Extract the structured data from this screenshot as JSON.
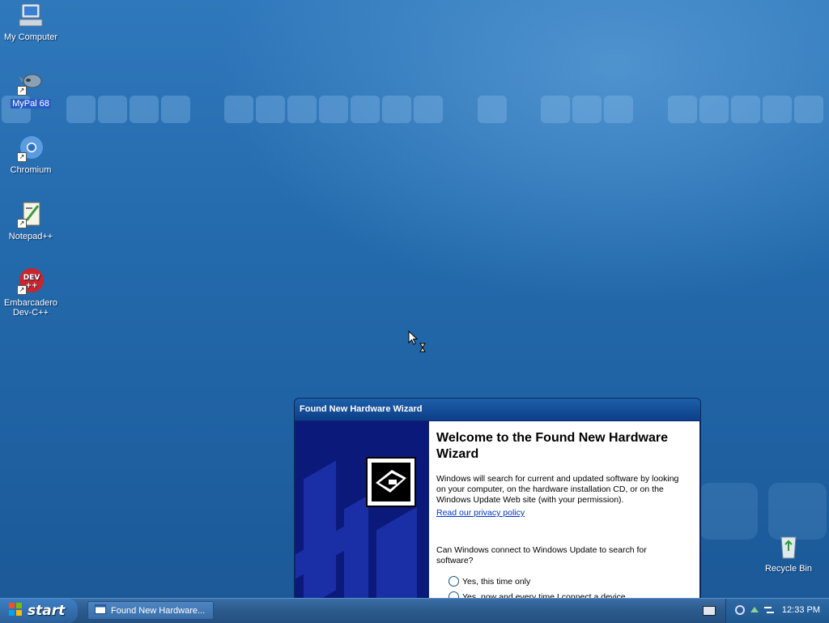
{
  "desktop": {
    "icons": [
      {
        "label": "My Computer",
        "selected": false
      },
      {
        "label": "MyPal 68",
        "selected": true
      },
      {
        "label": "Chromium",
        "selected": false
      },
      {
        "label": "Notepad++",
        "selected": false
      },
      {
        "label": "Embarcadero Dev-C++",
        "selected": false
      },
      {
        "label": "Recycle Bin",
        "selected": false
      }
    ]
  },
  "wizard": {
    "title": "Found New Hardware Wizard",
    "heading": "Welcome to the Found New Hardware Wizard",
    "description": "Windows will search for current and updated software by looking on your computer, on the hardware installation CD, or on the Windows Update Web site (with your permission).",
    "privacy_link": "Read our privacy policy",
    "question": "Can Windows connect to Windows Update to search for software?",
    "options": [
      "Yes, this time only",
      "Yes, now and every time I connect a device"
    ]
  },
  "taskbar": {
    "start_label": "start",
    "task_label": "Found New Hardware...",
    "clock": "12:33 PM"
  },
  "colors": {
    "desktop_blue": "#236aac",
    "taskbar_blue": "#2b5a8c",
    "wizard_sidebar": "#0b1a7a",
    "link": "#0033cc"
  }
}
